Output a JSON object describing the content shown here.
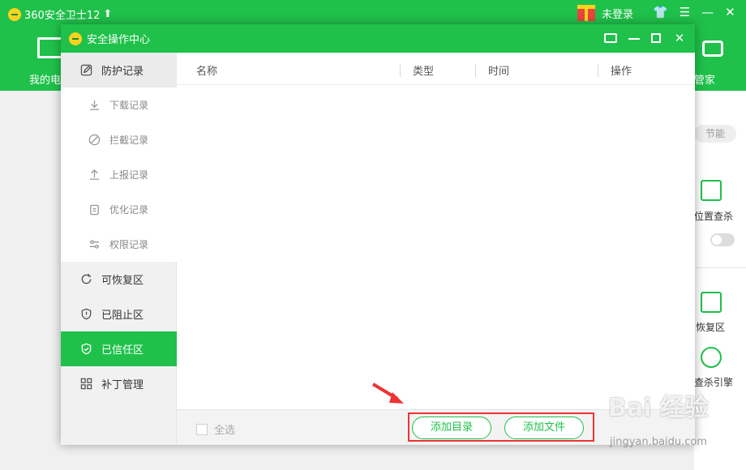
{
  "app": {
    "title": "360安全卫士12",
    "login": "未登录",
    "my_computer": "我的电",
    "steward": "管家",
    "energy": "节能",
    "location_scan": "位置查杀",
    "restore_zone": "恢复区",
    "scan_engine": "查杀引擎"
  },
  "dialog": {
    "title": "安全操作中心"
  },
  "sidebar": {
    "items": [
      {
        "label": "防护记录",
        "icon": "edit-icon"
      },
      {
        "label": "下载记录",
        "icon": "download-icon"
      },
      {
        "label": "拦截记录",
        "icon": "block-icon"
      },
      {
        "label": "上报记录",
        "icon": "upload-icon"
      },
      {
        "label": "优化记录",
        "icon": "clipboard-icon"
      },
      {
        "label": "权限记录",
        "icon": "permission-icon"
      },
      {
        "label": "可恢复区",
        "icon": "refresh-icon"
      },
      {
        "label": "已阻止区",
        "icon": "shield-alert-icon"
      },
      {
        "label": "已信任区",
        "icon": "shield-check-icon"
      },
      {
        "label": "补丁管理",
        "icon": "grid-icon"
      }
    ]
  },
  "table": {
    "columns": [
      "名称",
      "类型",
      "时间",
      "操作"
    ]
  },
  "footer": {
    "select_all": "全选",
    "add_dir": "添加目录",
    "add_file": "添加文件"
  },
  "watermark": {
    "brand": "Bai 经验",
    "url": "jingyan.baidu.com"
  },
  "colors": {
    "accent": "#1fc14a",
    "highlight": "#e33333"
  }
}
